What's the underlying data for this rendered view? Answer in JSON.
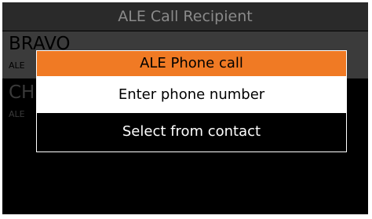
{
  "screen": {
    "title": "ALE Call Recipient"
  },
  "recipients": [
    {
      "name": "BRAVO",
      "detail": "ALE"
    },
    {
      "name": "CH",
      "detail": "ALE"
    }
  ],
  "dialog": {
    "title": "ALE Phone call",
    "options": [
      {
        "label": "Enter phone number",
        "selected": true
      },
      {
        "label": "Select from contact",
        "selected": false
      }
    ],
    "colors": {
      "header": "#f07a24",
      "selected_bg": "#ffffff",
      "background": "#000000"
    }
  }
}
